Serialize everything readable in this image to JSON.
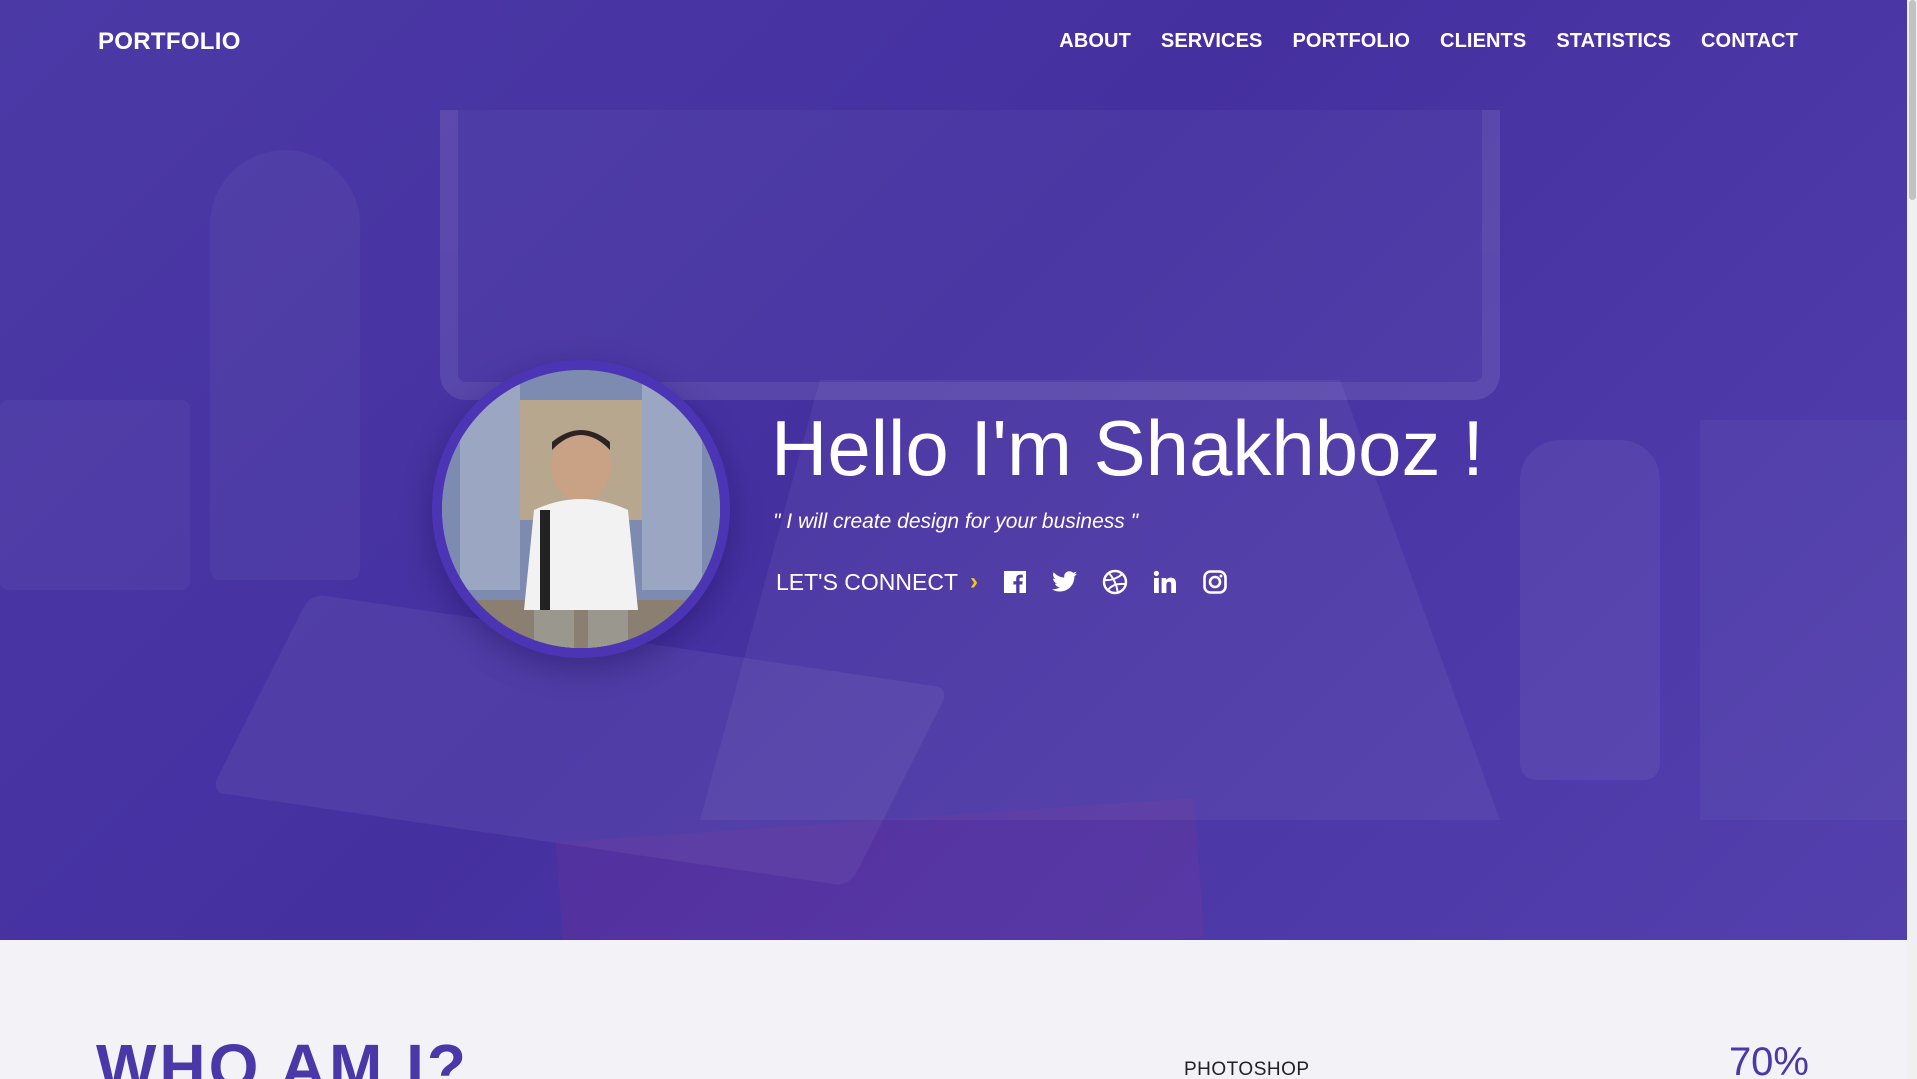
{
  "brand": "PORTFOLIO",
  "nav": [
    "ABOUT",
    "SERVICES",
    "PORTFOLIO",
    "CLIENTS",
    "STATISTICS",
    "CONTACT"
  ],
  "hero": {
    "greeting": "Hello I'm Shakhboz !",
    "tagline": "\" I will create design for your business \"",
    "cta": "LET'S CONNECT",
    "social_icons": [
      "facebook-icon",
      "twitter-icon",
      "dribbble-icon",
      "linkedin-icon",
      "instagram-icon"
    ]
  },
  "about": {
    "title": "WHO AM I?",
    "skills": [
      {
        "name": "PHOTOSHOP",
        "percent": "70%"
      }
    ]
  },
  "colors": {
    "hero_bg": "#4b3aa6",
    "accent": "#4b38a8",
    "chevron": "#f5c518",
    "section_bg": "#f3f2f7"
  }
}
